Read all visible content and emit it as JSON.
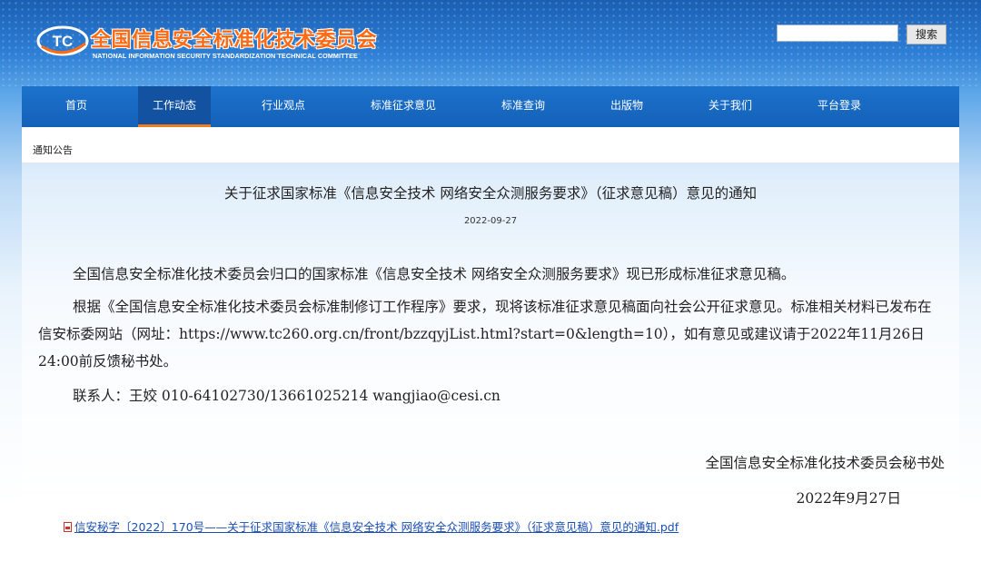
{
  "header": {
    "title": "全国信息安全标准化技术委员会",
    "subtitle": "NATIONAL INFORMATION SECURITY STANDARDIZATION TECHNICAL COMMITTEE",
    "logo_text": "TC",
    "search_button": "搜索",
    "search_value": ""
  },
  "nav": {
    "items": [
      {
        "label": "首页"
      },
      {
        "label": "工作动态",
        "active": true
      },
      {
        "label": "行业观点"
      },
      {
        "label": "标准征求意见"
      },
      {
        "label": "标准查询"
      },
      {
        "label": "出版物"
      },
      {
        "label": "关于我们"
      },
      {
        "label": "平台登录"
      }
    ]
  },
  "breadcrumb": "通知公告",
  "article": {
    "title": "关于征求国家标准《信息安全技术 网络安全众测服务要求》（征求意见稿）意见的通知",
    "date": "2022-09-27",
    "paragraphs": [
      "全国信息安全标准化技术委员会归口的国家标准《信息安全技术 网络安全众测服务要求》现已形成标准征求意见稿。",
      "根据《全国信息安全标准化技术委员会标准制修订工作程序》要求，现将该标准征求意见稿面向社会公开征求意见。标准相关材料已发布在信安标委网站（网址：https://www.tc260.org.cn/front/bzzqyjList.html?start=0&length=10），如有意见或建议请于2022年11月26日24:00前反馈秘书处。",
      "联系人：王姣 010-64102730/13661025214 wangjiao@cesi.cn"
    ],
    "signature": "全国信息安全标准化技术委员会秘书处",
    "sign_date": "2022年9月27日",
    "attachment": "信安秘字〔2022〕170号——关于征求国家标准《信息安全技术 网络安全众测服务要求》（征求意见稿）意见的通知.pdf"
  },
  "colors": {
    "nav_bg": "#1668c2",
    "nav_active_underline": "#f07c1f",
    "title_orange": "#ff6a13",
    "link_blue": "#1a4fb5"
  }
}
